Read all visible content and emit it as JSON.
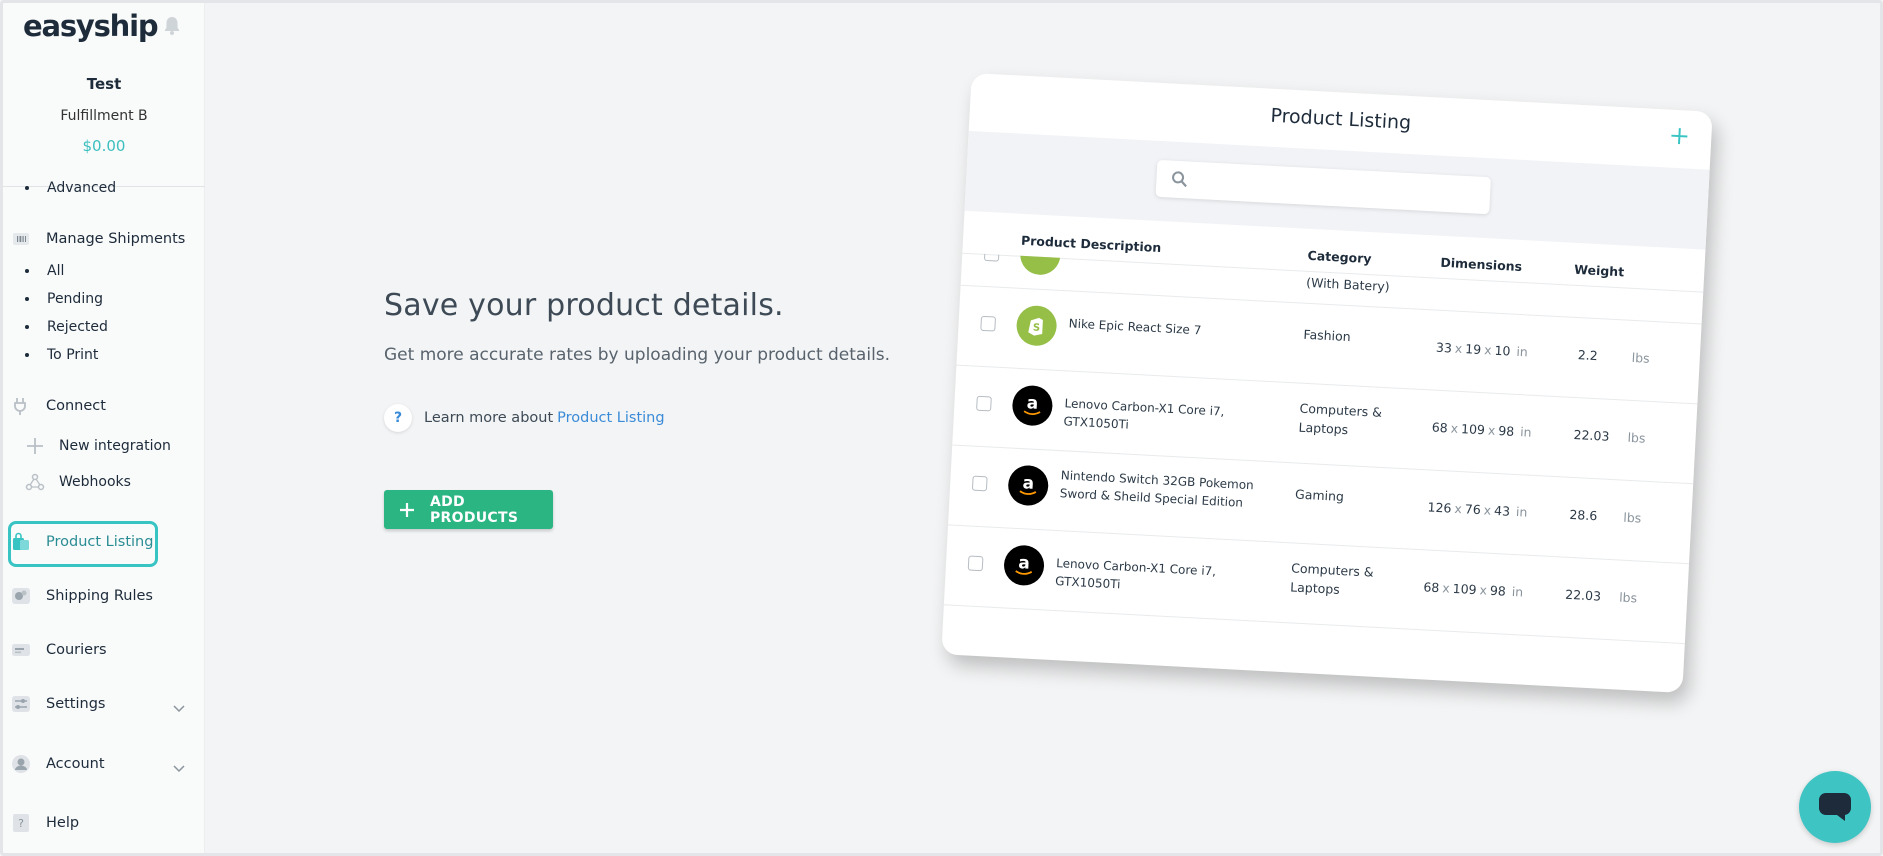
{
  "brand": {
    "logo": "easyship",
    "bell_icon": "bell-icon"
  },
  "account": {
    "name": "Test",
    "company": "Fulfillment B",
    "balance": "$0.00"
  },
  "sidebar": {
    "cut_item": "Advanced",
    "manage_shipments": {
      "label": "Manage Shipments",
      "icon": "barcode-icon",
      "items": [
        "All",
        "Pending",
        "Rejected",
        "To Print"
      ]
    },
    "connect": {
      "label": "Connect",
      "icon": "plug-icon",
      "items": [
        {
          "label": "New integration",
          "icon": "plus-icon"
        },
        {
          "label": "Webhooks",
          "icon": "webhook-icon"
        }
      ]
    },
    "product_listing": {
      "label": "Product Listing",
      "icon": "shopping-bag-icon"
    },
    "shipping_rules": {
      "label": "Shipping Rules",
      "icon": "rules-icon"
    },
    "couriers": {
      "label": "Couriers",
      "icon": "truck-icon"
    },
    "settings": {
      "label": "Settings",
      "icon": "settings-icon"
    },
    "account": {
      "label": "Account",
      "icon": "user-icon"
    },
    "help": {
      "label": "Help",
      "icon": "help-book-icon"
    }
  },
  "hero": {
    "title": "Save your product details.",
    "subtitle": "Get more accurate rates by uploading your product details.",
    "learn_prefix": "Learn more about",
    "learn_link": "Product Listing",
    "add_button": "ADD PRODUCTS"
  },
  "mock": {
    "title": "Product Listing",
    "headers": {
      "description": "Product Description",
      "category": "Category",
      "dimensions": "Dimensions",
      "weight": "Weight"
    },
    "cut_category": "(With Batery)",
    "rows": [
      {
        "store": "shopify",
        "description": "Nike Epic React Size 7",
        "category": "Fashion",
        "l": "33",
        "w": "19",
        "h": "10",
        "dim_unit": "in",
        "weight": "2.2",
        "weight_unit": "lbs"
      },
      {
        "store": "amazon",
        "description": "Lenovo Carbon-X1 Core i7, GTX1050Ti",
        "category": "Computers & Laptops",
        "l": "68",
        "w": "109",
        "h": "98",
        "dim_unit": "in",
        "weight": "22.03",
        "weight_unit": "lbs"
      },
      {
        "store": "amazon",
        "description": "Nintendo Switch 32GB Pokemon Sword & Sheild Special Edition",
        "category": "Gaming",
        "l": "126",
        "w": "76",
        "h": "43",
        "dim_unit": "in",
        "weight": "28.6",
        "weight_unit": "lbs"
      },
      {
        "store": "amazon",
        "description": "Lenovo Carbon-X1 Core i7, GTX1050Ti",
        "category": "Computers & Laptops",
        "l": "68",
        "w": "109",
        "h": "98",
        "dim_unit": "in",
        "weight": "22.03",
        "weight_unit": "lbs"
      }
    ],
    "dim_separator": "x"
  },
  "colors": {
    "accent": "#39c4c4",
    "primary_button": "#2bb583",
    "link": "#3a8bd8",
    "shopify": "#95bf47",
    "amazon": "#000000"
  },
  "chat": {
    "icon": "chat-bubble-icon"
  }
}
